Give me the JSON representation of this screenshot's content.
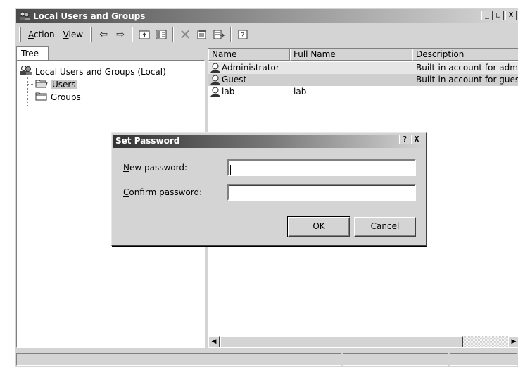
{
  "window": {
    "title": "Local Users and Groups",
    "controls": {
      "minimize": "_",
      "maximize": "□",
      "close": "X"
    }
  },
  "toolbar": {
    "menus": [
      {
        "label": "Action",
        "mnemonic": "A"
      },
      {
        "label": "View",
        "mnemonic": "V"
      }
    ],
    "icons": [
      "back-arrow-icon",
      "forward-arrow-icon",
      "up-folder-icon",
      "show-hide-tree-icon",
      "delete-icon",
      "properties-icon",
      "export-list-icon",
      "help-icon"
    ]
  },
  "tree": {
    "tab_label": "Tree",
    "root": "Local Users and Groups (Local)",
    "children": [
      {
        "label": "Users",
        "selected": true
      },
      {
        "label": "Groups",
        "selected": false
      }
    ]
  },
  "list": {
    "columns": [
      "Name",
      "Full Name",
      "Description"
    ],
    "rows": [
      {
        "name": "Administrator",
        "full_name": "",
        "description": "Built-in account for admini"
      },
      {
        "name": "Guest",
        "full_name": "",
        "description": "Built-in account for guest"
      },
      {
        "name": "lab",
        "full_name": "lab",
        "description": ""
      }
    ]
  },
  "dialog": {
    "title": "Set Password",
    "help_button": "?",
    "close_button": "X",
    "new_password_label": "New password:",
    "new_password_mnemonic": "N",
    "confirm_password_label": "Confirm password:",
    "confirm_password_mnemonic": "C",
    "new_password_value": "",
    "confirm_password_value": "",
    "ok_label": "OK",
    "cancel_label": "Cancel"
  },
  "colors": {
    "face": "#d4d4d4",
    "title_dark": "#4a4a4a",
    "selection": "#c8c8c8"
  }
}
